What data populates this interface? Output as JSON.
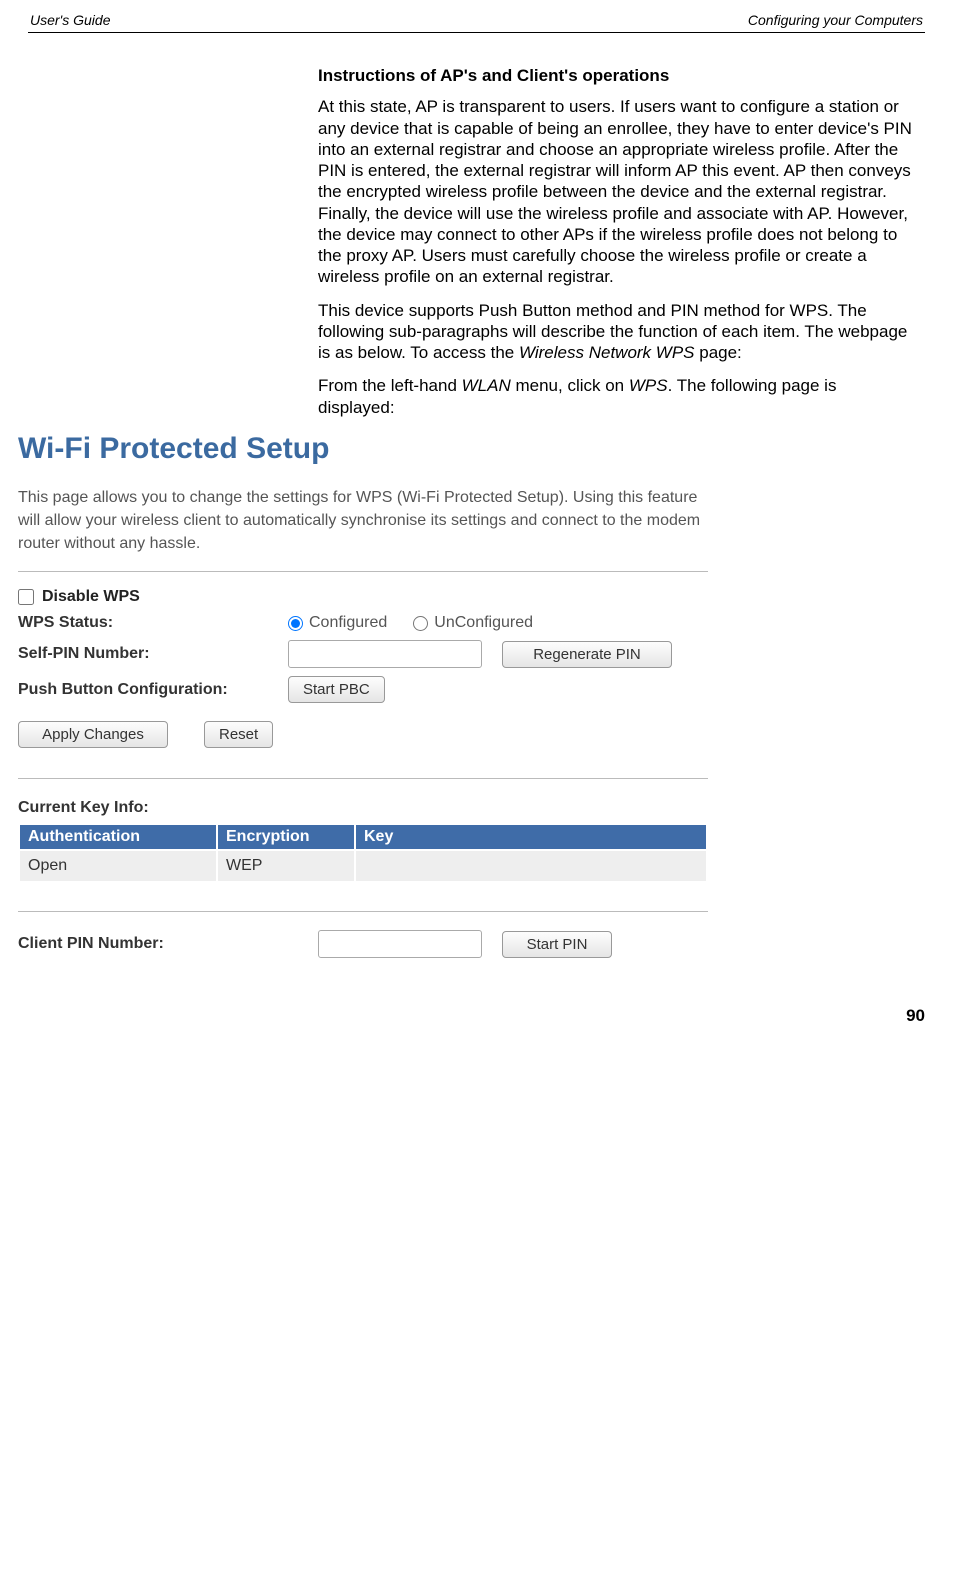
{
  "header": {
    "left": "User's Guide",
    "right": "Configuring your Computers"
  },
  "doc": {
    "heading": "Instructions of AP's and Client's operations",
    "p1": "At this state, AP is transparent to users. If users want to configure a station or any device that is capable of being an enrollee, they have to enter device's PIN into an external registrar and choose an appropriate wireless profile. After the PIN is entered, the external registrar will inform AP this event. AP then conveys the encrypted wireless profile between the device and the external registrar. Finally, the device will use the wireless profile and associate with AP. However, the device may connect to other APs if the wireless profile does not belong to the proxy AP. Users must carefully choose the wireless profile or create a wireless profile on an external registrar.",
    "p2a": "This device supports Push Button method and PIN method for WPS. The following sub-paragraphs will describe the function of each item. The webpage is as below. To access the ",
    "p2i": "Wireless Network WPS",
    "p2b": " page:",
    "p3a": "From the left-hand ",
    "p3i1": "WLAN",
    "p3b": " menu, click on ",
    "p3i2": "WPS",
    "p3c": ". The following page is displayed:"
  },
  "wps": {
    "title": "Wi-Fi Protected Setup",
    "desc": "This page allows you to change the settings for WPS (Wi-Fi Protected Setup). Using this feature will allow your wireless client to automatically synchronise its settings and connect to the modem router without any hassle.",
    "disable_label": "Disable WPS",
    "status_label": "WPS Status:",
    "status_opt1": "Configured",
    "status_opt2": "UnConfigured",
    "selfpin_label": "Self-PIN Number:",
    "regen_btn": "Regenerate PIN",
    "pbc_label": "Push Button Configuration:",
    "pbc_btn": "Start PBC",
    "apply_btn": "Apply Changes",
    "reset_btn": "Reset",
    "keyinfo_label": "Current Key Info:",
    "table": {
      "h1": "Authentication",
      "h2": "Encryption",
      "h3": "Key",
      "r1c1": "Open",
      "r1c2": "WEP",
      "r1c3": ""
    },
    "clientpin_label": "Client PIN Number:",
    "startpin_btn": "Start PIN"
  },
  "page_number": "90"
}
